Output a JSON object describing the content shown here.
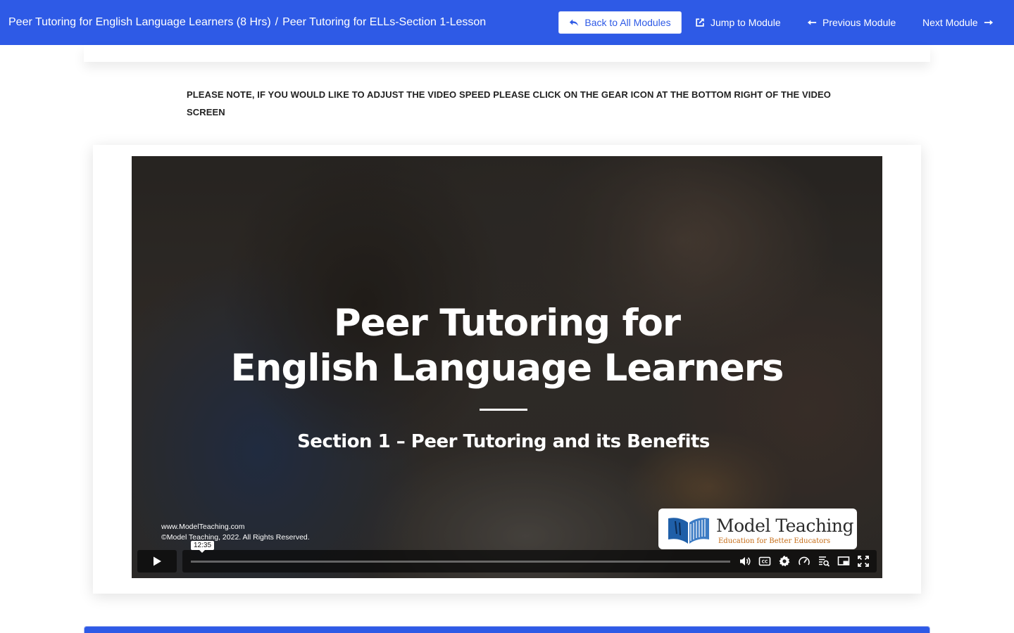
{
  "header": {
    "course": "Peer Tutoring for English Language Learners (8 Hrs)",
    "separator": "/",
    "lesson": "Peer Tutoring for ELLs-Section 1-Lesson",
    "back_label": "Back to All Modules",
    "jump_label": "Jump to Module",
    "prev_label": "Previous Module",
    "next_label": "Next Module",
    "accent_color": "#2e5ae6"
  },
  "note": "PLEASE NOTE, IF YOU WOULD LIKE TO ADJUST THE VIDEO SPEED PLEASE CLICK ON THE GEAR ICON AT THE BOTTOM RIGHT OF THE VIDEO SCREEN",
  "video": {
    "title_line1": "Peer Tutoring for",
    "title_line2": "English Language Learners",
    "subtitle": "Section 1 – Peer Tutoring and its Benefits",
    "website": "www.ModelTeaching.com",
    "copyright": "©Model Teaching, 2022.  All Rights Reserved.",
    "logo_name": "Model Teaching",
    "logo_tagline": "Education for Better Educators",
    "duration": "12:35",
    "progress": 0,
    "controls": [
      "play-icon",
      "volume-icon",
      "captions-icon",
      "gear-icon",
      "speed-icon",
      "transcript-search-icon",
      "picture-in-picture-icon",
      "fullscreen-icon"
    ]
  }
}
